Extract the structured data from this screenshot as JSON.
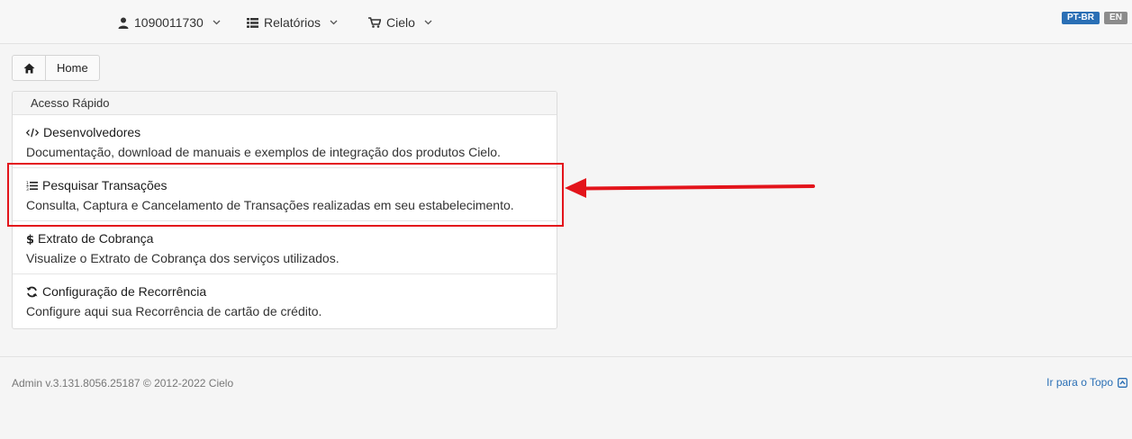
{
  "nav": {
    "account": "1090011730",
    "reports": "Relatórios",
    "store": "Cielo"
  },
  "languages": {
    "pt": "PT-BR",
    "en": "EN"
  },
  "breadcrumb": {
    "home": "Home"
  },
  "quick_access": {
    "title": "Acesso Rápido",
    "items": [
      {
        "title": "Desenvolvedores",
        "desc": "Documentação, download de manuais e exemplos de integração dos produtos Cielo.",
        "icon": "code-icon"
      },
      {
        "title": "Pesquisar Transações",
        "desc": "Consulta, Captura e Cancelamento de Transações realizadas em seu estabelecimento.",
        "icon": "list-icon"
      },
      {
        "title": "Extrato de Cobrança",
        "desc": "Visualize o Extrato de Cobrança dos serviços utilizados.",
        "icon": "dollar-icon"
      },
      {
        "title": "Configuração de Recorrência",
        "desc": "Configure aqui sua Recorrência de cartão de crédito.",
        "icon": "refresh-icon"
      }
    ]
  },
  "footer": {
    "version": "Admin v.3.131.8056.25187 © 2012-2022 Cielo",
    "top_link": "Ir para o Topo"
  },
  "colors": {
    "accent": "#2a6fb5",
    "highlight": "#e3141b"
  }
}
